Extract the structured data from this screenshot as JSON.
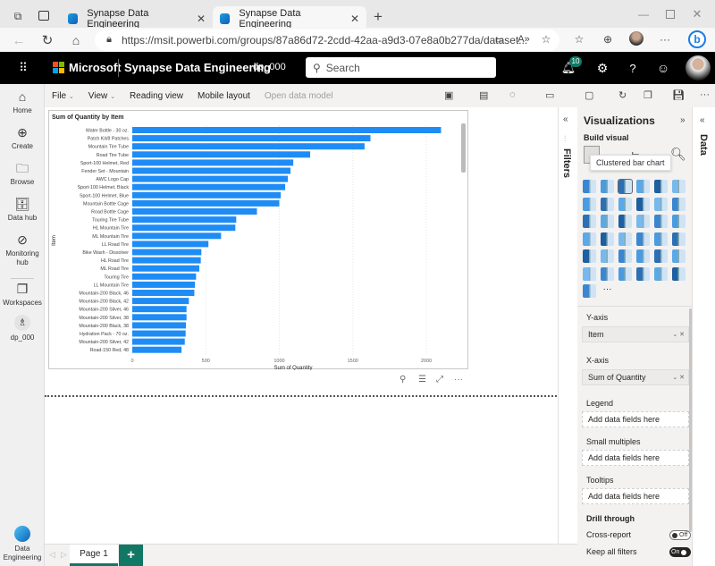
{
  "browser": {
    "tabs": [
      {
        "title": "Synapse Data Engineering",
        "active": false
      },
      {
        "title": "Synapse Data Engineering",
        "active": true
      }
    ],
    "new_tab_label": "+",
    "url": "https://msit.powerbi.com/groups/87a86d72-2cdd-42aa-a9d3-07e8a0b277da/dataset..."
  },
  "header": {
    "brand": "Microsoft",
    "app_title": "Synapse Data Engineering",
    "workspace": "dp_000",
    "search_placeholder": "Search",
    "notification_count": "10",
    "help_label": "?"
  },
  "leftnav": {
    "items": [
      {
        "label": "Home",
        "icon": "home-icon"
      },
      {
        "label": "Create",
        "icon": "create-icon"
      },
      {
        "label": "Browse",
        "icon": "folder-icon"
      },
      {
        "label": "Data hub",
        "icon": "data-hub-icon"
      },
      {
        "label": "Monitoring hub",
        "icon": "monitoring-icon"
      },
      {
        "label": "Workspaces",
        "icon": "workspaces-icon"
      },
      {
        "label": "dp_000",
        "icon": "workspace-icon"
      }
    ],
    "bottom": {
      "label_line1": "Data",
      "label_line2": "Engineering"
    }
  },
  "ribbon": {
    "file": "File",
    "view": "View",
    "reading_view": "Reading view",
    "mobile_layout": "Mobile layout",
    "open_data_model": "Open data model",
    "more": "···"
  },
  "visual_footer": {
    "more": "···"
  },
  "filters_pane": {
    "label": "Filters"
  },
  "data_pane": {
    "label": "Data"
  },
  "visualizations": {
    "title": "Visualizations",
    "build_visual": "Build visual",
    "tooltip": "Clustered bar chart",
    "more_visuals": "···",
    "wells": {
      "y_axis": {
        "label": "Y-axis",
        "field": "Item"
      },
      "x_axis": {
        "label": "X-axis",
        "field": "Sum of Quantity"
      },
      "legend": {
        "label": "Legend",
        "placeholder": "Add data fields here"
      },
      "small_multiples": {
        "label": "Small multiples",
        "placeholder": "Add data fields here"
      },
      "tooltips": {
        "label": "Tooltips",
        "placeholder": "Add data fields here"
      }
    },
    "drill_through": {
      "title": "Drill through",
      "cross_report": {
        "label": "Cross-report",
        "state": "Off"
      },
      "keep_all_filters": {
        "label": "Keep all filters",
        "state": "On"
      }
    }
  },
  "pages": {
    "tabs": [
      "Page 1"
    ],
    "add_label": "+"
  },
  "colors": {
    "bar": "#1f8cf5",
    "accent": "#117865",
    "header_bg": "#000000"
  },
  "chart_data": {
    "type": "bar",
    "orientation": "horizontal",
    "title": "Sum of Quantity by Item",
    "xlabel": "Sum of Quantity",
    "ylabel": "Item",
    "xlim": [
      0,
      2200
    ],
    "xticks": [
      0,
      500,
      1000,
      1500,
      2000
    ],
    "grid": true,
    "categories": [
      "Water Bottle - 30 oz.",
      "Patch Kit/8 Patches",
      "Mountain Tire Tube",
      "Road Tire Tube",
      "Sport-100 Helmet, Red",
      "Fender Set - Mountain",
      "AWC Logo Cap",
      "Sport-100 Helmet, Black",
      "Sport-100 Helmet, Blue",
      "Mountain Bottle Cage",
      "Road Bottle Cage",
      "Touring Tire Tube",
      "HL Mountain Tire",
      "ML Mountain Tire",
      "LL Road Tire",
      "Bike Wash - Dissolver",
      "HL Road Tire",
      "ML Road Tire",
      "Touring Tire",
      "LL Mountain Tire",
      "Mountain-200 Black, 46",
      "Mountain-200 Black, 42",
      "Mountain-200 Silver, 46",
      "Mountain-200 Silver, 38",
      "Mountain-200 Black, 38",
      "Hydration Pack - 70 oz.",
      "Mountain-200 Silver, 42",
      "Road-150 Red, 48"
    ],
    "values": [
      2100,
      1620,
      1580,
      1210,
      1095,
      1076,
      1058,
      1040,
      1010,
      1000,
      848,
      707,
      701,
      604,
      518,
      470,
      466,
      456,
      434,
      426,
      422,
      385,
      369,
      369,
      365,
      363,
      357,
      335
    ]
  }
}
